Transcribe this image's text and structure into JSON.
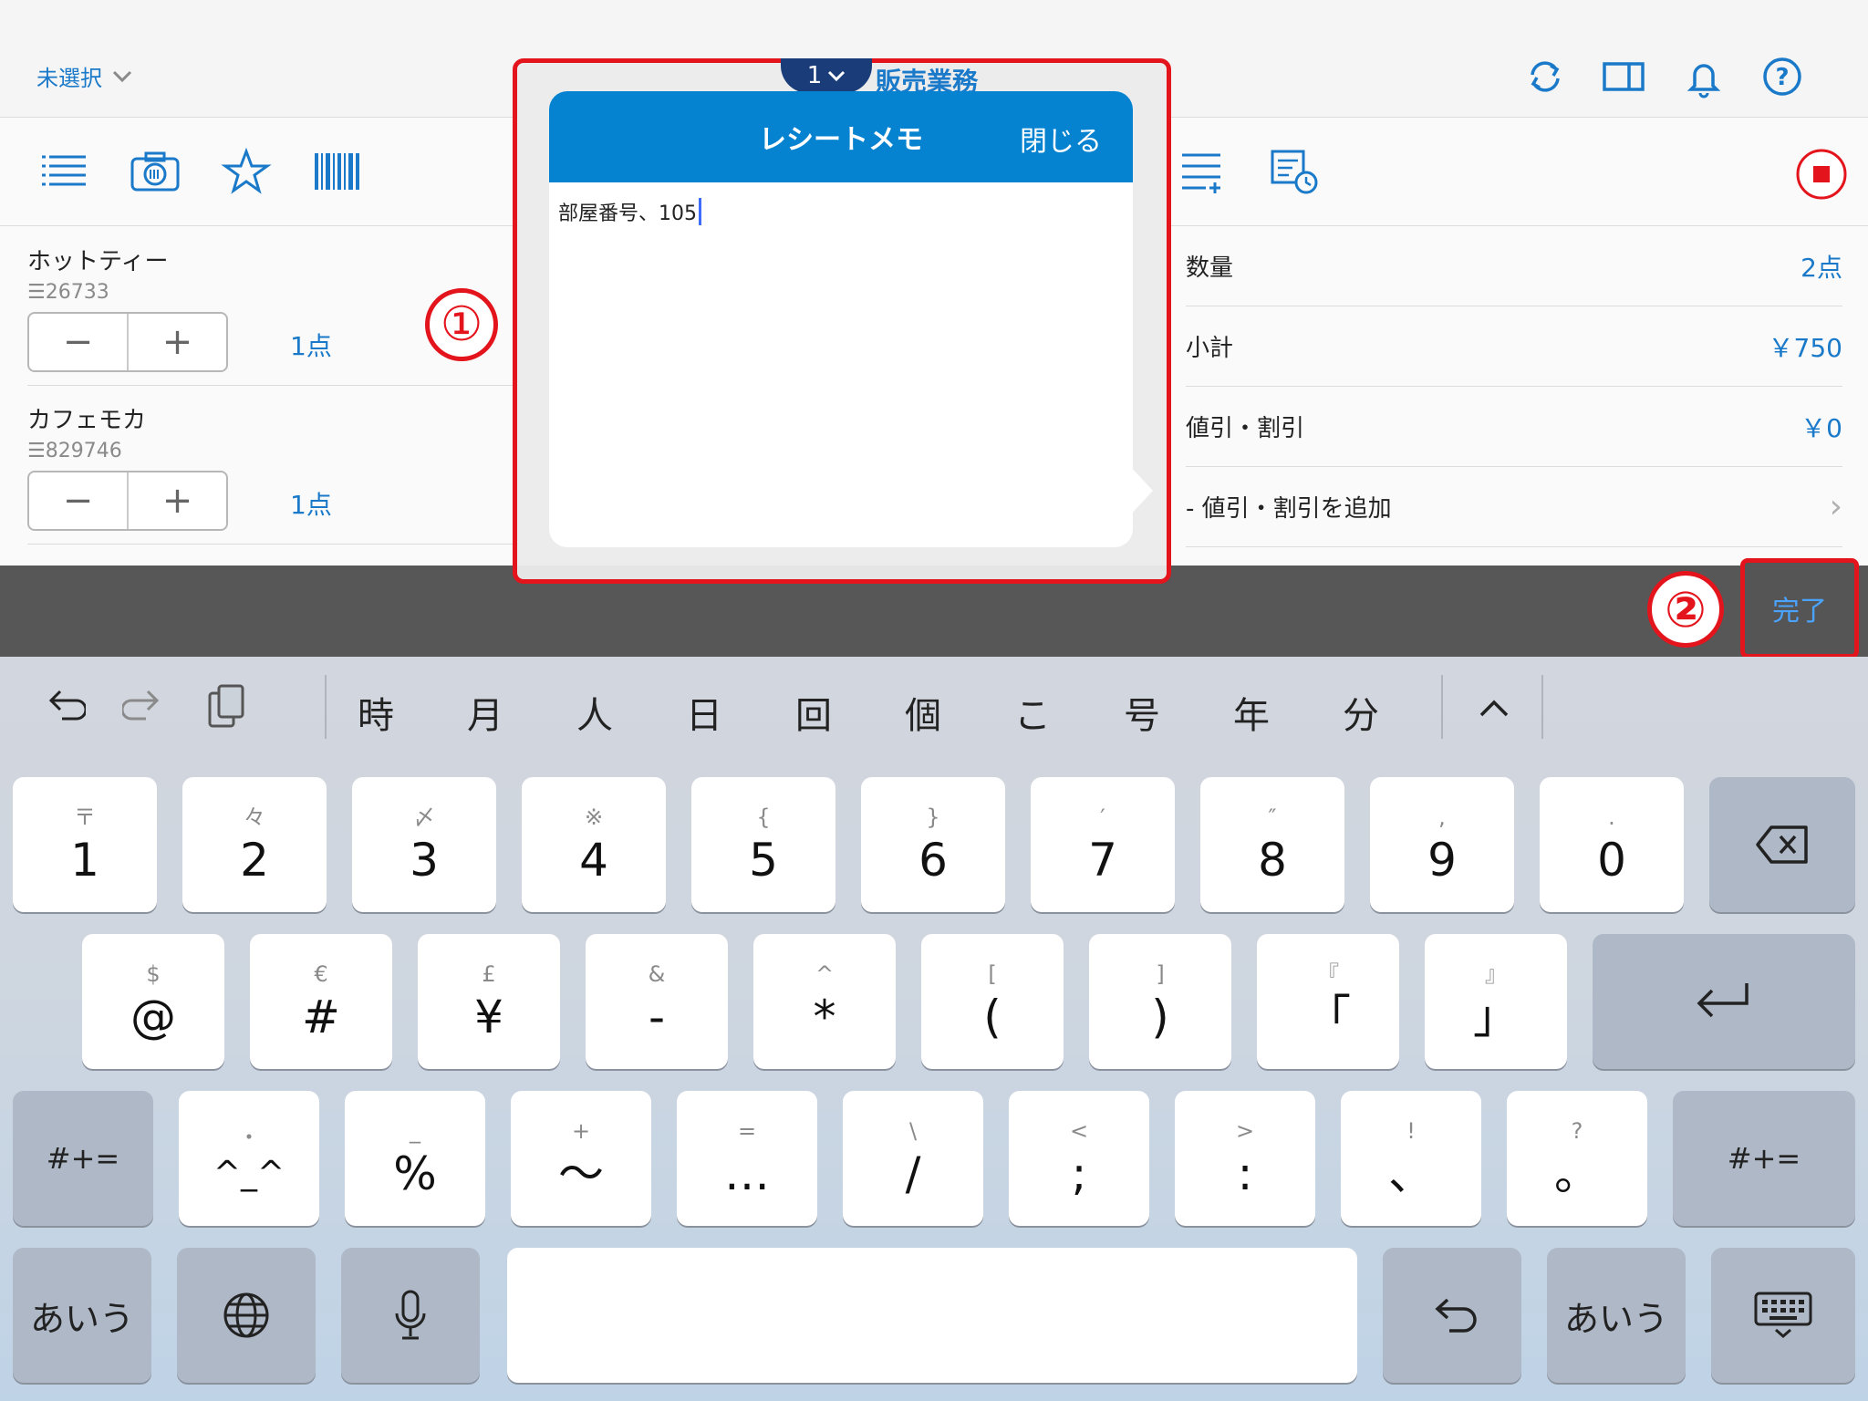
{
  "header": {
    "unselected_label": "未選択",
    "tab_number": "1",
    "business_label": "販売業務"
  },
  "items": [
    {
      "name": "ホットティー",
      "code": "26733",
      "qty": "1点"
    },
    {
      "name": "カフェモカ",
      "code": "829746",
      "qty": "1点"
    }
  ],
  "summary": [
    {
      "label": "数量",
      "value": "2点"
    },
    {
      "label": "小計",
      "value": "￥750"
    },
    {
      "label": "値引・割引",
      "value": "￥0"
    },
    {
      "label": "- 値引・割引を追加",
      "value": "›"
    }
  ],
  "popup": {
    "title": "レシートメモ",
    "close_label": "閉じる",
    "memo_text": "部屋番号、105"
  },
  "annotations": {
    "badge1": "①",
    "badge2": "②"
  },
  "done_label": "完了",
  "stepper": {
    "minus": "−",
    "plus": "+"
  },
  "candidates": [
    "時",
    "月",
    "人",
    "日",
    "回",
    "個",
    "こ",
    "号",
    "年",
    "分"
  ],
  "candidate_expand": "^",
  "keyboard": {
    "row1": [
      {
        "sub": "〒",
        "main": "1"
      },
      {
        "sub": "々",
        "main": "2"
      },
      {
        "sub": "〆",
        "main": "3"
      },
      {
        "sub": "※",
        "main": "4"
      },
      {
        "sub": "{",
        "main": "5"
      },
      {
        "sub": "}",
        "main": "6"
      },
      {
        "sub": "′",
        "main": "7"
      },
      {
        "sub": "″",
        "main": "8"
      },
      {
        "sub": ",",
        "main": "9"
      },
      {
        "sub": ".",
        "main": "0"
      }
    ],
    "row2": [
      {
        "sub": "$",
        "main": "@"
      },
      {
        "sub": "€",
        "main": "#"
      },
      {
        "sub": "£",
        "main": "¥"
      },
      {
        "sub": "&",
        "main": "-"
      },
      {
        "sub": "^",
        "main": "*"
      },
      {
        "sub": "[",
        "main": "("
      },
      {
        "sub": "]",
        "main": ")"
      },
      {
        "sub": "『",
        "main": "「"
      },
      {
        "sub": "』",
        "main": "」"
      }
    ],
    "row3": [
      {
        "sub": "・",
        "main": "^_^"
      },
      {
        "sub": "_",
        "main": "%"
      },
      {
        "sub": "+",
        "main": "〜"
      },
      {
        "sub": "=",
        "main": "…"
      },
      {
        "sub": "\\",
        "main": "/"
      },
      {
        "sub": "<",
        "main": ";"
      },
      {
        "sub": ">",
        "main": ":"
      },
      {
        "sub": "!",
        "main": "、"
      },
      {
        "sub": "?",
        "main": "。"
      }
    ],
    "symbol_toggle": "#+=",
    "kana_label": "あいう"
  }
}
